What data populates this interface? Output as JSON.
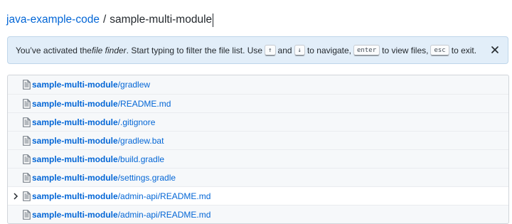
{
  "breadcrumb": {
    "repo": "java-example-code",
    "separator": "/",
    "query": "sample-multi-module"
  },
  "flash": {
    "text_before": "You’ve activated the ",
    "emphasis": "file finder",
    "text_mid1": ". Start typing to filter the file list. Use ",
    "key_up": "↑",
    "text_and": " and ",
    "key_down": "↓",
    "text_mid2": " to navigate, ",
    "key_enter": "enter",
    "text_mid3": " to view files, ",
    "key_esc": "esc",
    "text_end": " to exit.",
    "close_icon": "close-icon"
  },
  "files": [
    {
      "match": "sample-multi-module",
      "rest": "/gradlew"
    },
    {
      "match": "sample-multi-module",
      "rest": "/README.md"
    },
    {
      "match": "sample-multi-module",
      "rest": "/.gitignore"
    },
    {
      "match": "sample-multi-module",
      "rest": "/gradlew.bat"
    },
    {
      "match": "sample-multi-module",
      "rest": "/build.gradle"
    },
    {
      "match": "sample-multi-module",
      "rest": "/settings.gradle"
    },
    {
      "match": "sample-multi-module",
      "rest": "/admin-api/README.md",
      "selected": true
    },
    {
      "match": "sample-multi-module",
      "rest": "/admin-api/README.md"
    }
  ],
  "colors": {
    "link": "#0366d6",
    "flash_bg": "#e2eef9",
    "list_bg": "#f6f8fa"
  }
}
